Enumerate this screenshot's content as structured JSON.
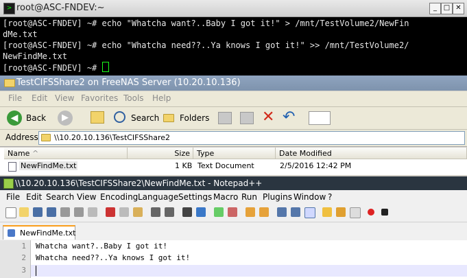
{
  "terminal": {
    "title": "root@ASC-FNDEV:~",
    "lines": [
      "[root@ASC-FNDEV] ~# echo \"Whatcha want?..Baby I got it!\" > /mnt/TestVolume2/NewFin",
      "dMe.txt",
      "[root@ASC-FNDEV] ~# echo \"Whatcha need??..Ya knows I got it!\" >> /mnt/TestVolume2/",
      "NewFindMe.txt",
      "[root@ASC-FNDEV] ~# "
    ]
  },
  "explorer": {
    "title": "TestCIFSShare2 on FreeNAS Server (10.20.10.136)",
    "menu": [
      "File",
      "Edit",
      "View",
      "Favorites",
      "Tools",
      "Help"
    ],
    "toolbar": {
      "back": "Back",
      "search": "Search",
      "folders": "Folders"
    },
    "address_label": "Address",
    "address_value": "\\\\10.20.10.136\\TestCIFSShare2",
    "columns": [
      "Name",
      "Size",
      "Type",
      "Date Modified"
    ],
    "rows": [
      {
        "name": "NewFindMe.txt",
        "size": "1 KB",
        "type": "Text Document",
        "date": "2/5/2016 12:42 PM"
      }
    ]
  },
  "notepad": {
    "title": "\\\\10.20.10.136\\TestCIFSShare2\\NewFindMe.txt - Notepad++",
    "menu": [
      "File",
      "Edit",
      "Search",
      "View",
      "Encoding",
      "Language",
      "Settings",
      "Macro",
      "Run",
      "Plugins",
      "Window",
      "?"
    ],
    "tab": "NewFindMe.txt",
    "line_numbers": [
      "1",
      "2",
      "3"
    ],
    "lines": [
      "Whatcha want?..Baby I got it!",
      "Whatcha need??..Ya knows I got it!",
      ""
    ]
  },
  "colors": {
    "accent": "#fa9d1a",
    "terminal_bg": "#000000",
    "cursor": "#1aff1a"
  }
}
